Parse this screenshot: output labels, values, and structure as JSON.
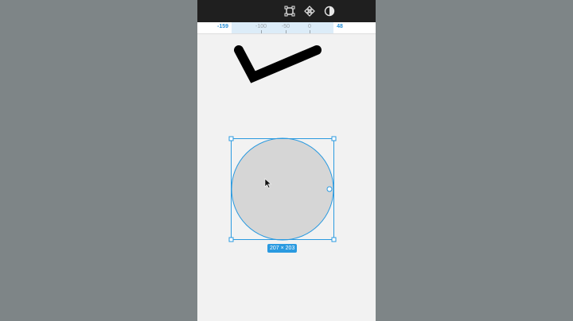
{
  "toolbar": {
    "icons": [
      "frame-icon",
      "component-icon",
      "contrast-icon"
    ]
  },
  "ruler": {
    "labels": [
      "-159",
      "-100",
      "-50",
      "0",
      "48"
    ]
  },
  "selection": {
    "dimensions_label": "207 × 203"
  },
  "colors": {
    "accent": "#2a9ae0",
    "shape_fill": "#d6d6d6",
    "stroke": "#000000",
    "canvas": "#f2f2f2",
    "toolbar": "#1f1f1f"
  }
}
